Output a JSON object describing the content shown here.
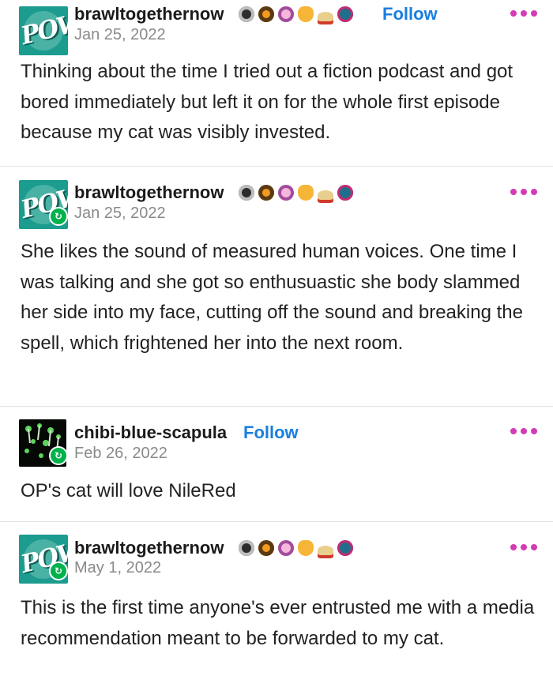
{
  "posts": [
    {
      "username": "brawltogethernow",
      "follow_label": "Follow",
      "date": "Jan 25, 2022",
      "text": "Thinking about the time I tried out a fiction podcast and got bored immediately but left it on for the whole first episode because my cat was visibly invested."
    },
    {
      "username": "brawltogethernow",
      "date": "Jan 25, 2022",
      "text": "She likes the sound of measured human voices. One time I was talking and she got so enthusuastic she body slammed her side into my face, cutting off the sound and breaking the spell, which frightened her into the next room."
    },
    {
      "username": "chibi-blue-scapula",
      "follow_label": "Follow",
      "date": "Feb 26, 2022",
      "text": "OP's cat will love NileRed"
    },
    {
      "username": "brawltogethernow",
      "date": "May 1, 2022",
      "text": "This is the first time anyone's ever entrusted me with a media recommendation meant to be forwarded to my cat."
    }
  ],
  "avatar_text": "POW",
  "badge_icons": [
    "paw-badge-icon",
    "paw-orange-badge-icon",
    "paw-pink-badge-icon",
    "crab-icon",
    "hat-icon",
    "open-sign-icon"
  ],
  "colors": {
    "follow": "#1a7ee0",
    "more_dots": "#d43bb4",
    "reblog": "#00b24c",
    "date": "#8a8a8a"
  }
}
